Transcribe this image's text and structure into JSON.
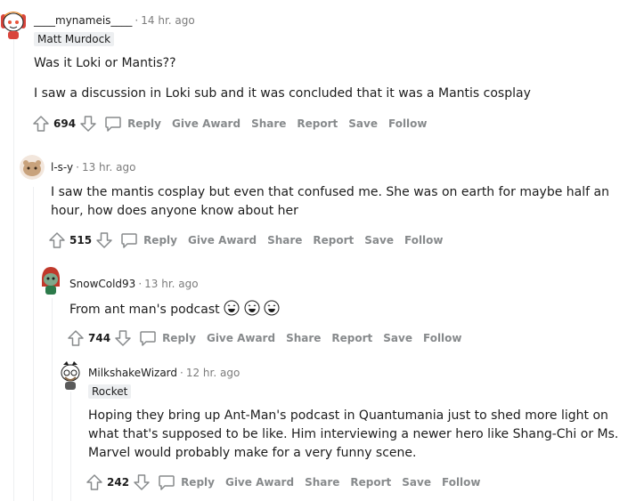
{
  "comments": [
    {
      "username": "____mynameis____",
      "time": "14 hr. ago",
      "flair": "Matt Murdock",
      "paragraphs": [
        "Was it Loki or Mantis??",
        "I saw a discussion in Loki sub and it was concluded that it was a Mantis cosplay"
      ],
      "score": "694",
      "actions": {
        "reply": "Reply",
        "award": "Give Award",
        "share": "Share",
        "report": "Report",
        "save": "Save",
        "follow": "Follow"
      }
    },
    {
      "username": "l-s-y",
      "time": "13 hr. ago",
      "paragraphs": [
        "I saw the mantis cosplay but even that confused me. She was on earth for maybe half an hour, how does anyone know about her"
      ],
      "score": "515",
      "actions": {
        "reply": "Reply",
        "award": "Give Award",
        "share": "Share",
        "report": "Report",
        "save": "Save",
        "follow": "Follow"
      }
    },
    {
      "username": "SnowCold93",
      "time": "13 hr. ago",
      "text": "From ant man's podcast",
      "emoji": "laughing-tears",
      "score": "744",
      "actions": {
        "reply": "Reply",
        "award": "Give Award",
        "share": "Share",
        "report": "Report",
        "save": "Save",
        "follow": "Follow"
      }
    },
    {
      "username": "MilkshakeWizard",
      "time": "12 hr. ago",
      "flair": "Rocket",
      "paragraphs": [
        "Hoping they bring up Ant-Man's podcast in Quantumania just to shed more light on what that's supposed to be like. Him interviewing a newer hero like Shang-Chi or Ms. Marvel would probably make for a very funny scene."
      ],
      "score": "242",
      "actions": {
        "reply": "Reply",
        "award": "Give Award",
        "share": "Share",
        "report": "Report",
        "save": "Save",
        "follow": "Follow"
      }
    }
  ],
  "separator": "·"
}
